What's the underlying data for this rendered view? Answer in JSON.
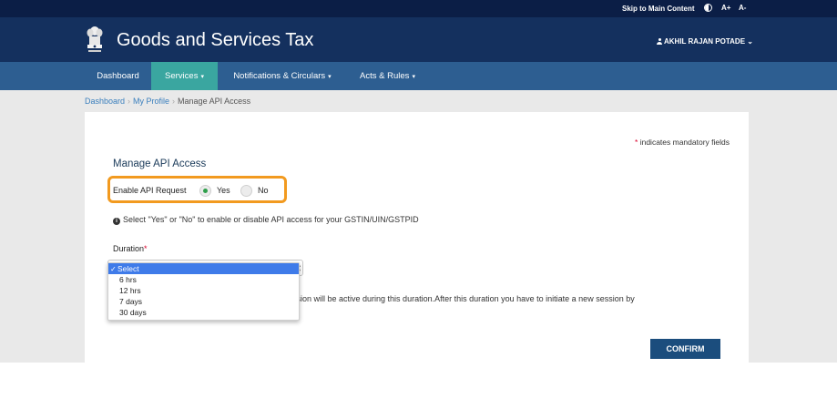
{
  "topbar": {
    "skip_link": "Skip to Main Content",
    "contrast_icon": "contrast-icon",
    "font_increase": "A+",
    "font_decrease": "A-"
  },
  "header": {
    "emblem_icon": "national-emblem-icon",
    "title": "Goods and Services Tax",
    "user_name": "AKHIL RAJAN POTADE",
    "user_caret": "⌄",
    "colors": {
      "topbar": "#0b1e46",
      "header": "#14305e",
      "nav": "#2d5e91",
      "nav_active": "#3aa6a0"
    }
  },
  "nav": {
    "items": [
      {
        "label": "Dashboard",
        "caret": ""
      },
      {
        "label": "Services",
        "caret": "▾",
        "active": true
      },
      {
        "label": "Notifications & Circulars",
        "caret": "▾"
      },
      {
        "label": "Acts & Rules",
        "caret": "▾"
      }
    ]
  },
  "breadcrumb": {
    "items": [
      "Dashboard",
      "My Profile",
      "Manage API Access"
    ],
    "separator": "›"
  },
  "form": {
    "mandatory_star": "*",
    "mandatory_note": "indicates mandatory fields",
    "section_title": "Manage API Access",
    "enable_label": "Enable API Request",
    "options": [
      {
        "label": "Yes",
        "checked": true
      },
      {
        "label": "No",
        "checked": false
      }
    ],
    "info_icon": "info-icon",
    "info_text": "Select \"Yes\" or \"No\" to enable or disable API access for your GSTIN/UIN/GSTPID",
    "duration_label": "Duration",
    "duration_star": "*",
    "duration_selected": "Select",
    "duration_options": [
      "Select",
      "6 hrs",
      "12 hrs",
      "7 days",
      "30 days"
    ],
    "session_text": "ession will be active during this duration.After this duration you have to initiate a new session by",
    "confirm_label": "CONFIRM",
    "accent_color": "#f29a1f",
    "radio_checked_color": "#2e9f4a",
    "dropdown_highlight_color": "#3f7be9"
  }
}
